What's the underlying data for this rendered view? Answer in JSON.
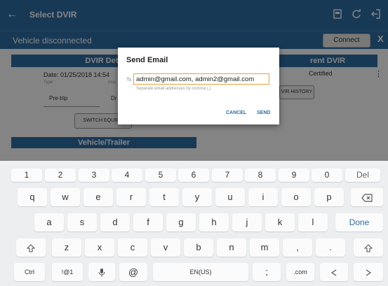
{
  "header": {
    "back_icon": "←",
    "title": "Select DVIR",
    "icons": [
      "pdf-icon",
      "refresh-icon",
      "logout-icon"
    ]
  },
  "status_bar": {
    "text": "Vehicle disconnected",
    "connect_label": "Connect",
    "close_label": "X"
  },
  "dvir_details": {
    "header": "DVIR Deta",
    "date": "Date: 01/25/2018 14:54",
    "type_label": "Type:",
    "inspection_label": "Insp",
    "type_value": "Pre-trip",
    "second_value": "Dr",
    "switch_label": "SWITCH EQUIPM"
  },
  "current_dvir": {
    "header": "rent DVIR",
    "status": "Certified",
    "history_label": "VIR HISTORY",
    "menu_icon": "⋮"
  },
  "vehicle": {
    "header": "Vehicle/Trailer"
  },
  "dialog": {
    "title": "Send Email",
    "to_label": "To",
    "to_value": "admin@gmail.com, admin2@gmail.com",
    "hint": "Separate email addresses by comma (,)",
    "cancel_label": "CANCEL",
    "send_label": "SEND"
  },
  "keyboard": {
    "row1": [
      "1",
      "2",
      "3",
      "4",
      "5",
      "6",
      "7",
      "8",
      "9",
      "0",
      "Del"
    ],
    "row2": [
      "q",
      "w",
      "e",
      "r",
      "t",
      "y",
      "u",
      "i",
      "o",
      "p"
    ],
    "row3": [
      "a",
      "s",
      "d",
      "f",
      "g",
      "h",
      "j",
      "k",
      "l",
      "Done"
    ],
    "row4": [
      "z",
      "x",
      "c",
      "v",
      "b",
      "n",
      "m",
      ",",
      "."
    ],
    "row5": [
      "Ctrl",
      "!@1",
      "@",
      "EN(US)",
      ";",
      ".com"
    ]
  },
  "colors": {
    "primary": "#2e6ea5",
    "input_border": "#e5a23a",
    "done": "#2e6ea5"
  }
}
